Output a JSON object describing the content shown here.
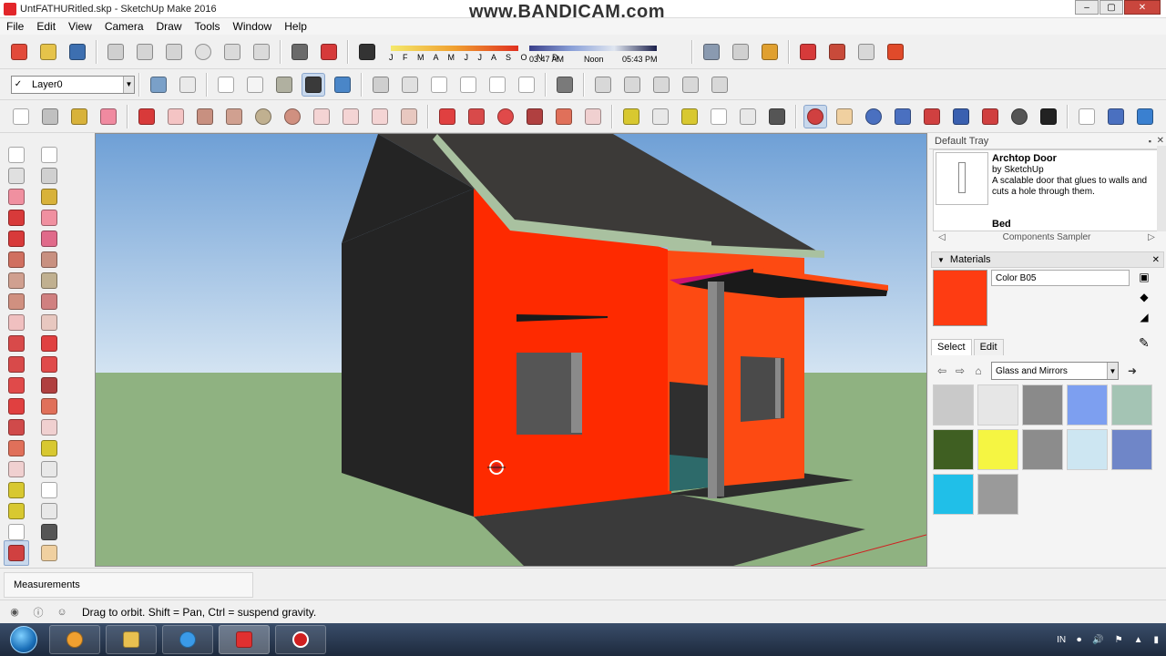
{
  "window": {
    "title": "UntFATHURitled.skp - SketchUp Make 2016",
    "watermark": "www.BANDICAM.com",
    "controls": [
      "–",
      "▢",
      "✕"
    ]
  },
  "menu": [
    "File",
    "Edit",
    "View",
    "Camera",
    "Draw",
    "Tools",
    "Window",
    "Help"
  ],
  "layer": {
    "current": "Layer0",
    "check": "✓"
  },
  "shadow": {
    "months": "J F M A M J J A S O N D",
    "time_start": "03:47 AM",
    "time_mid": "Noon",
    "time_end": "05:43 PM"
  },
  "tray": {
    "title": "Default Tray",
    "component": {
      "title": "Archtop Door",
      "author": "by SketchUp",
      "description": "A scalable door that glues to walls and cuts a hole through them.",
      "next_title": "Bed"
    },
    "components_sampler": "Components Sampler",
    "materials": {
      "title": "Materials",
      "current_name": "Color B05",
      "current_color": "#fe3c12",
      "tabs": [
        "Select",
        "Edit"
      ],
      "collection": "Glass and Mirrors",
      "swatch_colors": [
        "#c9c9c9",
        "#e6e6e6",
        "#8a8a8a",
        "#7d9ff0",
        "#a4c4b4",
        "#3f5f22",
        "#f5f542",
        "#8c8c8c",
        "#cde6f2",
        "#6f86c8",
        "#20bfe8",
        "#9a9a9a"
      ]
    }
  },
  "measurements": {
    "label": "Measurements"
  },
  "status": {
    "text": "Drag to orbit. Shift = Pan, Ctrl = suspend gravity."
  },
  "taskbar": {
    "lang": "IN"
  },
  "colors": {
    "sky_top": "#6fa0d6",
    "sky_bottom": "#d4e4f2",
    "ground": "#8fb281",
    "wall_front": "#fe2a00",
    "wall_side": "#242424",
    "roof": "#3c3a38",
    "porch": "#fd4a12",
    "fascia": "#a9c1a0"
  }
}
